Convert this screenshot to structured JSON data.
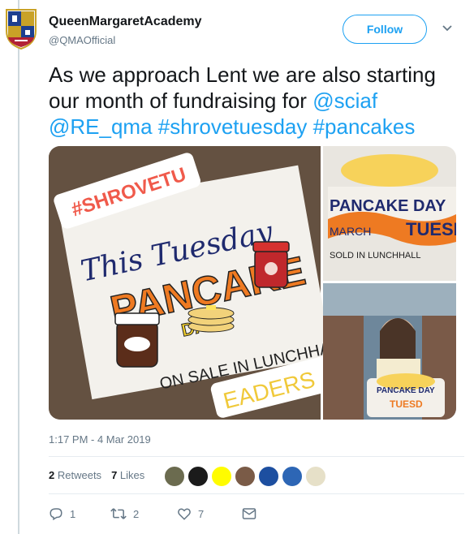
{
  "account": {
    "name": "QueenMargaretAcademy",
    "handle": "@QMAOfficial"
  },
  "follow_label": "Follow",
  "tweet": {
    "text_plain_1": "As we approach Lent we are also starting our month of fundraising for ",
    "mention_1": "@sciaf",
    "mention_2": "@RE_qma",
    "hashtag_1": "#shrovetuesday",
    "hashtag_2": "#pancakes"
  },
  "media": {
    "main_poster": {
      "line1": "This Tuesday",
      "line2": "PANCAKE",
      "line3": "DAY",
      "line4": "ON SALE IN LUNCHHA",
      "sticker_top": "#SHROVETU",
      "sticker_bottom": "EADERS"
    },
    "top_right": {
      "line1": "PANCAKE DAY",
      "line2": "MARCH",
      "line3": "TUESD",
      "line4": "SOLD IN LUNCHHALL"
    },
    "bottom_right": {
      "line1": "PANCAKE DAY",
      "line2": "TUESD"
    }
  },
  "timestamp": "1:17 PM - 4 Mar 2019",
  "stats": {
    "retweets_count": "2",
    "retweets_label": "Retweets",
    "likes_count": "7",
    "likes_label": "Likes"
  },
  "actions": {
    "reply_count": "1",
    "retweet_count": "2",
    "like_count": "7"
  },
  "colors": {
    "accent": "#1da1f2",
    "secondary_text": "#657786",
    "divider": "#e6ecf0"
  }
}
